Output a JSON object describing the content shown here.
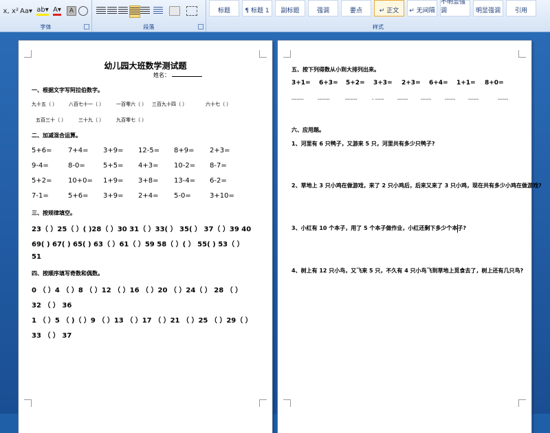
{
  "ribbon": {
    "font_group": {
      "title": "字体",
      "buttons": [
        "x,",
        "x²",
        "Aa▾",
        "ab▾",
        "A▾"
      ]
    },
    "paragraph_group": {
      "title": "段落"
    },
    "styles_group": {
      "title": "样式",
      "items": [
        {
          "label": "标题"
        },
        {
          "label": "¶ 标题 1"
        },
        {
          "label": "副标题"
        },
        {
          "label": "强调"
        },
        {
          "label": "要点"
        },
        {
          "label": "↵ 正文",
          "selected": true
        },
        {
          "label": "↵ 无间隔"
        },
        {
          "label": "不明显强调"
        },
        {
          "label": "明显强调"
        },
        {
          "label": "引用"
        }
      ]
    }
  },
  "page1": {
    "title": "幼儿园大班数学测试题",
    "name_label": "姓名：",
    "section1": {
      "heading": "一、根据文字写阿拉伯数字。",
      "row1": [
        "九十五（  ）",
        "八百七十一（  ）",
        "一百零六（  ）",
        "三百九十四（  ）",
        "六十七（  ）"
      ],
      "row2": [
        "五百三十（  ）",
        "三十九（  ）",
        "九百零七（  ）"
      ]
    },
    "section2": {
      "heading": "二、加减混合运算。",
      "rows": [
        [
          "5+6=",
          "7+4=",
          "3+9=",
          "12-5=",
          "8+9=",
          "2+3="
        ],
        [
          "9-4=",
          "8-0=",
          "5+5=",
          "4+3=",
          "10-2=",
          "8-7="
        ],
        [
          "5+2=",
          "10+0=",
          "1+9=",
          "3+8=",
          "13-4=",
          "6-2="
        ],
        [
          "7-1=",
          "5+6=",
          "3+9=",
          "2+4=",
          "5-0=",
          "3+10="
        ]
      ]
    },
    "section3": {
      "heading": "三、按规律填空。",
      "lines": [
        "23（  ）25（  ）(  )28（  ）30 31（  ）33(  ） 35(  ） 37（  ）39   40",
        "69(  ) 67(  ) 65(  ) 63（  ）61（  ）59 58（  ）(  ） 55(  ) 53（  ）",
        "51"
      ]
    },
    "section4": {
      "heading": "四、按顺序填写奇数和偶数。",
      "lines": [
        "0 （  ）4 （  ）8 （  ）12 （  ）16 （  ）20 （  ）24（  ） 28 （  ）",
        "32 （  ） 36",
        "1 （  ）5 （ )（  ）9 （  ）13 （  ）17 （  ）21 （  ）25 （  ）29（  ）",
        "33 （  ） 37"
      ]
    }
  },
  "page2": {
    "section5": {
      "heading": "五、按下列得数从小到大排列出来。",
      "items": [
        "3+1=",
        "6+3=",
        "5+2=",
        "3+3=",
        "2+3=",
        "6+4=",
        "1+1=",
        "8+0="
      ],
      "blanks": [
        "-------",
        "-------",
        "-------",
        "- -----",
        "------",
        "------",
        "------",
        "------",
        "------"
      ]
    },
    "section6": {
      "heading": "六、应用题。",
      "questions": [
        "1、河里有 6 只鸭子，又游来 5 只，河里共有多少只鸭子?",
        "2、草地上 3 只小鸡在做游戏，来了 2 只小鸡后，后来又来了 3 只小鸡，现在共有多少小鸡在做游戏?",
        "3、小红有 10 个本子，用了 5 个本子做作业，小红还剩下多少个本子?",
        "4、树上有 12 只小鸟，又飞来 5 只，不久有 4 只小鸟飞到草地上觅食去了，树上还有几只鸟?"
      ]
    }
  }
}
